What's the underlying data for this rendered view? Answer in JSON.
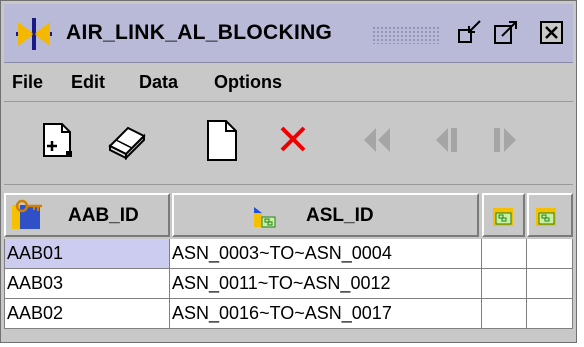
{
  "window": {
    "title": "AIR_LINK_AL_BLOCKING"
  },
  "menu": [
    "File",
    "Edit",
    "Data",
    "Options"
  ],
  "toolbar": {
    "tools": [
      "add-record-icon",
      "eraser-icon",
      "new-document-icon",
      "delete-icon",
      "first-record-icon",
      "previous-record-icon",
      "next-record-icon"
    ]
  },
  "table": {
    "columns": [
      "AAB_ID",
      "ASL_ID",
      "",
      ""
    ],
    "rows": [
      [
        "AAB01",
        "ASN_0003~TO~ASN_0004",
        "",
        ""
      ],
      [
        "AAB03",
        "ASN_0011~TO~ASN_0012",
        "",
        ""
      ],
      [
        "AAB02",
        "ASN_0016~TO~ASN_0017",
        "",
        ""
      ]
    ],
    "selected_row": 0
  }
}
